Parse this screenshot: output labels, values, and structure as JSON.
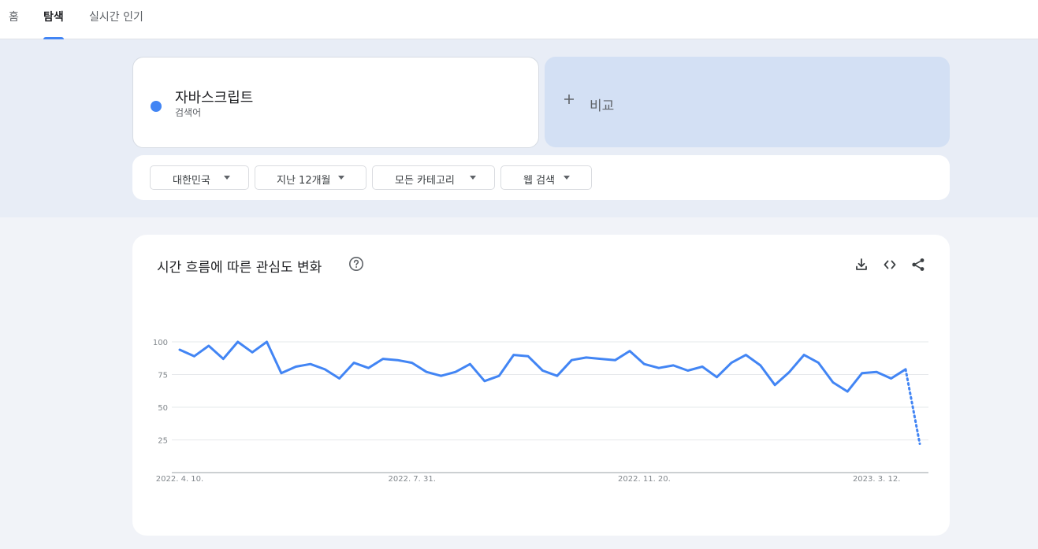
{
  "nav": {
    "tabs": [
      {
        "label": "홈",
        "active": false
      },
      {
        "label": "탐색",
        "active": true
      },
      {
        "label": "실시간 인기",
        "active": false
      }
    ]
  },
  "term": {
    "name": "자바스크립트",
    "type": "검색어",
    "color": "#4285f4"
  },
  "compare": {
    "label": "비교",
    "icon": "plus-icon"
  },
  "filters": [
    {
      "label": "대한민국"
    },
    {
      "label": "지난 12개월"
    },
    {
      "label": "모든 카테고리"
    },
    {
      "label": "웹 검색"
    }
  ],
  "chart_card": {
    "title": "시간 흐름에 따른 관심도 변화",
    "icons": [
      "help-icon",
      "download-icon",
      "embed-icon",
      "share-icon"
    ]
  },
  "chart_data": {
    "type": "line",
    "series": [
      {
        "color": "#4285f4",
        "values": [
          94,
          89,
          97,
          87,
          100,
          92,
          100,
          76,
          81,
          83,
          79,
          72,
          84,
          80,
          87,
          86,
          84,
          77,
          74,
          77,
          83,
          70,
          74,
          90,
          89,
          78,
          74,
          86,
          88,
          87,
          86,
          93,
          83,
          80,
          82,
          78,
          81,
          73,
          84,
          90,
          82,
          67,
          77,
          90,
          84,
          69,
          62,
          76,
          77,
          72,
          79
        ],
        "partial_last_value": 22
      }
    ],
    "y_ticks": [
      100,
      75,
      50,
      25
    ],
    "x_tick_labels": [
      {
        "label": "2022. 4. 10.",
        "index": 0
      },
      {
        "label": "2022. 7. 31.",
        "index": 16
      },
      {
        "label": "2022. 11. 20.",
        "index": 32
      },
      {
        "label": "2023. 3. 12.",
        "index": 48
      }
    ],
    "ylim": [
      0,
      100
    ],
    "grid": true,
    "legend": "none"
  }
}
